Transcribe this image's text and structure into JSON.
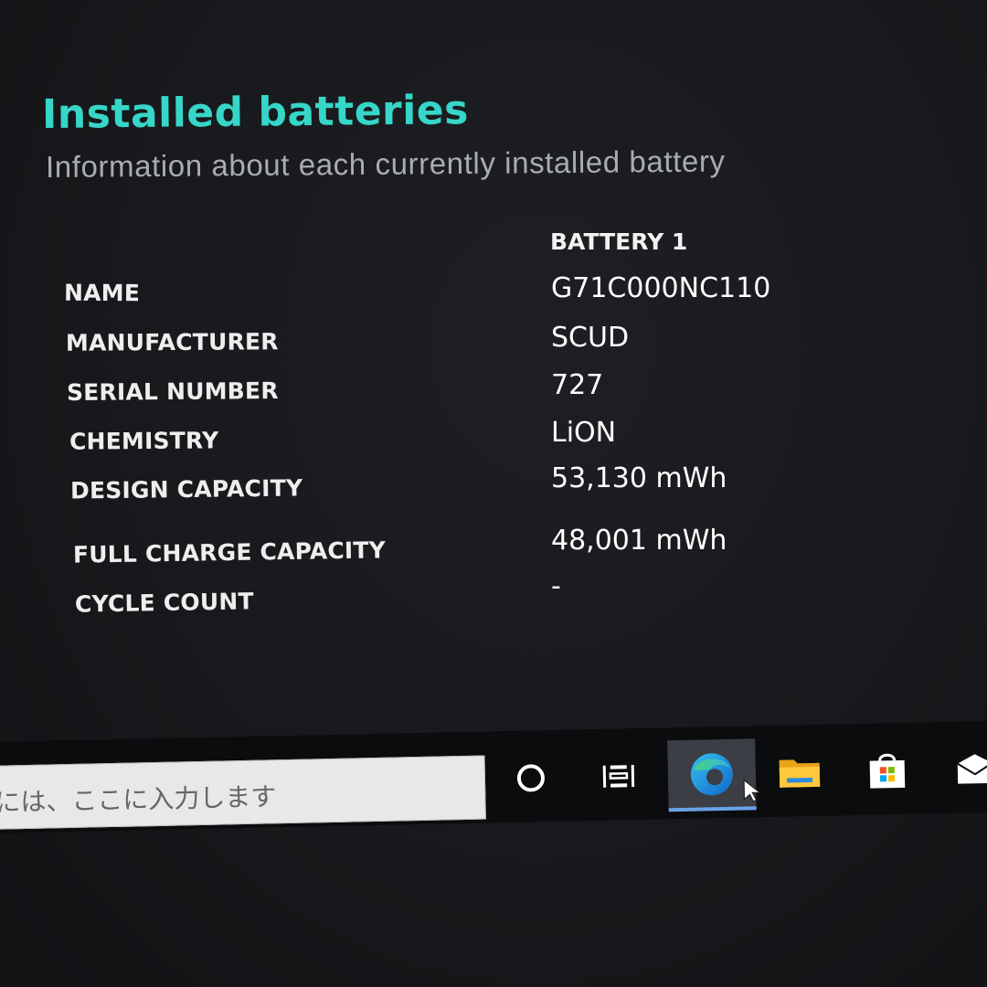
{
  "section": {
    "title": "Installed batteries",
    "subtitle": "Information about each currently installed battery"
  },
  "table": {
    "column_header": "BATTERY 1",
    "rows": [
      {
        "label": "NAME",
        "value": "G71C000NC110"
      },
      {
        "label": "MANUFACTURER",
        "value": "SCUD"
      },
      {
        "label": "SERIAL NUMBER",
        "value": "727"
      },
      {
        "label": "CHEMISTRY",
        "value": "LiON"
      },
      {
        "label": "DESIGN CAPACITY",
        "value": "53,130 mWh"
      },
      {
        "label": "FULL CHARGE CAPACITY",
        "value": "48,001 mWh"
      },
      {
        "label": "CYCLE COUNT",
        "value": "-"
      }
    ]
  },
  "taskbar": {
    "search_placeholder": "には、ここに入力します",
    "icons": [
      "cortana-icon",
      "task-view-icon",
      "edge-icon",
      "file-explorer-icon",
      "store-icon",
      "mail-icon"
    ],
    "active_icon": "edge-icon",
    "colors": {
      "accent_title": "#36d6c8",
      "active_underline": "#6aa3e8"
    }
  }
}
